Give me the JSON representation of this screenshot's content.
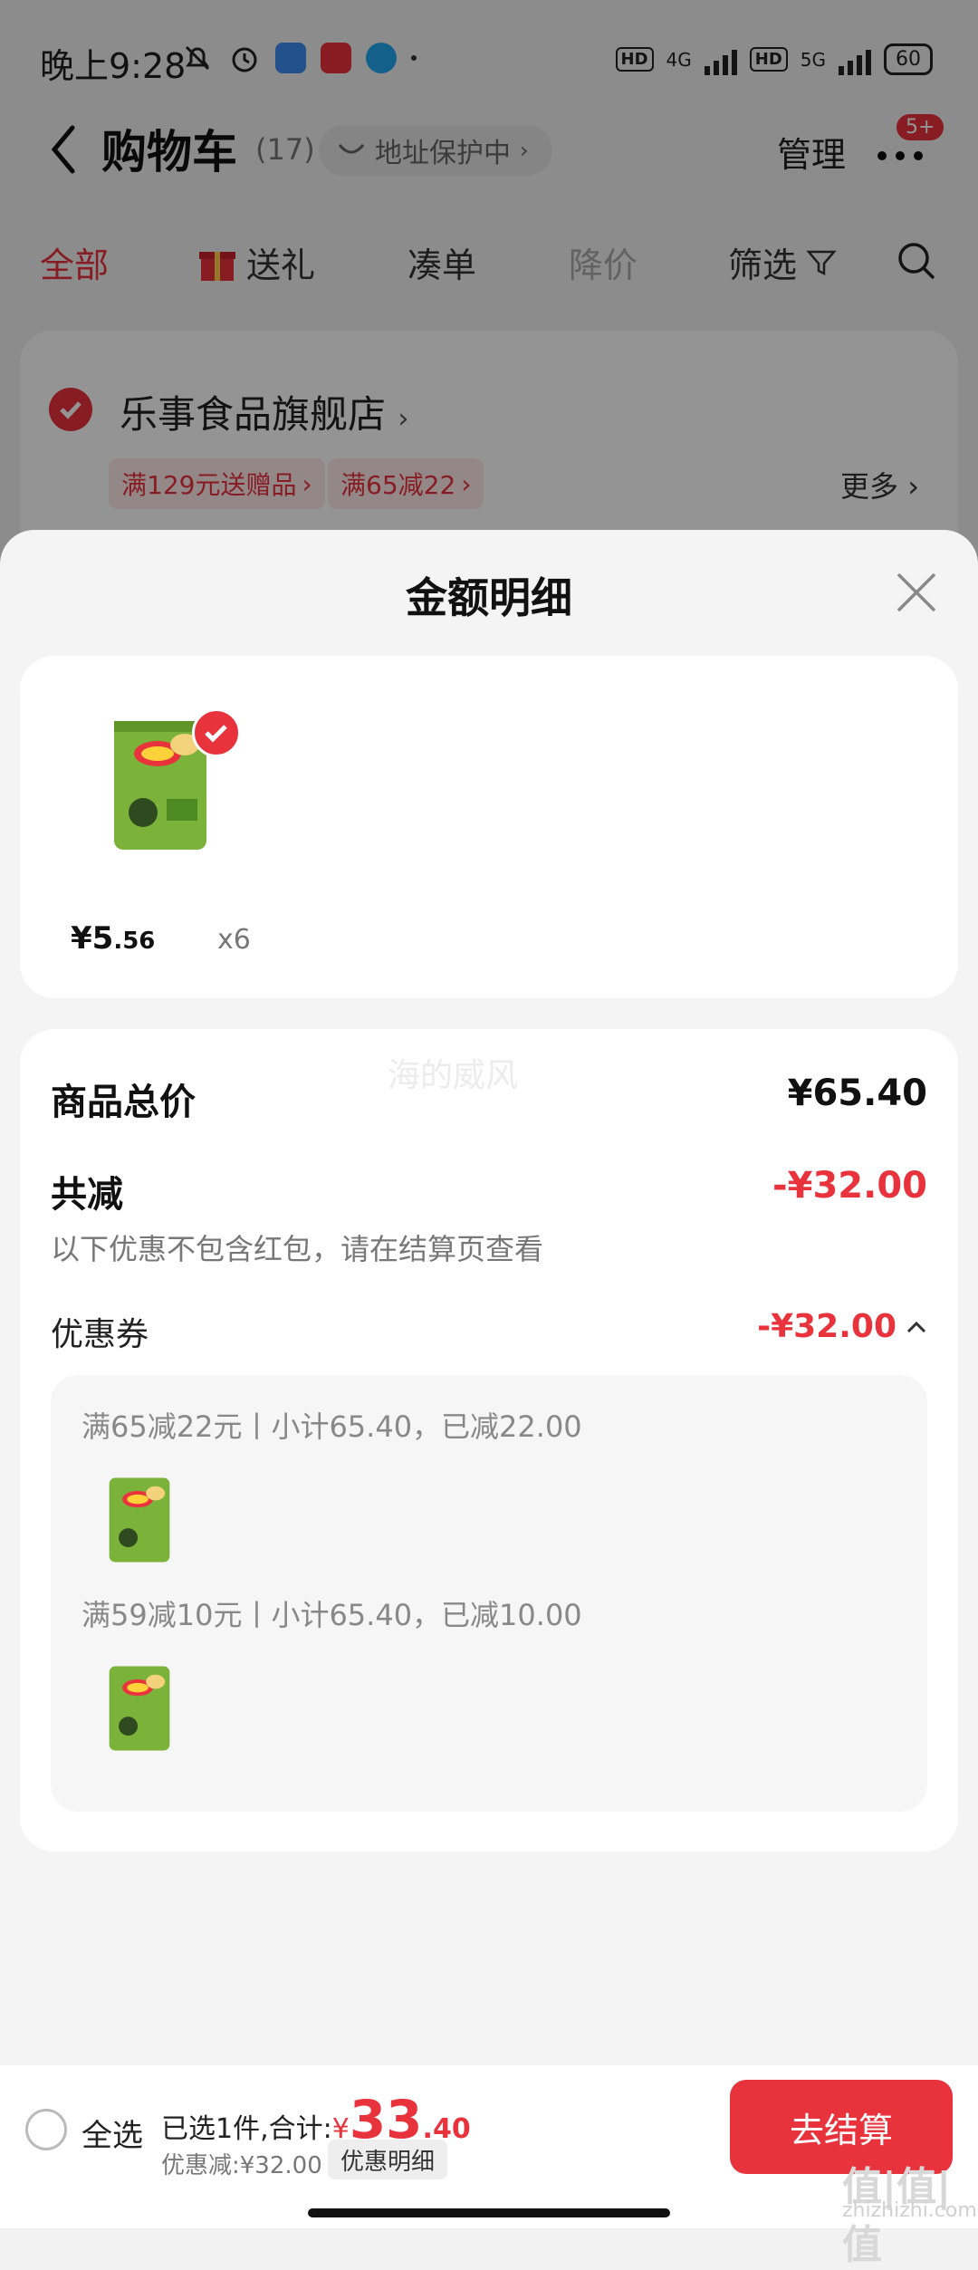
{
  "status_bar": {
    "time": "晚上9:28",
    "network_1": "4G",
    "network_2": "5G",
    "hd": "HD",
    "battery": "60"
  },
  "header": {
    "title": "购物车",
    "count": "(17)",
    "address_protect": "地址保护中",
    "manage": "管理",
    "more_badge": "5+"
  },
  "tabs": [
    {
      "label": "全部"
    },
    {
      "label": "送礼"
    },
    {
      "label": "凑单"
    },
    {
      "label": "降价"
    },
    {
      "label": "筛选"
    }
  ],
  "store": {
    "name": "乐事食品旗舰店",
    "promos": [
      "满129元送赠品",
      "满65减22"
    ],
    "more": "更多"
  },
  "sheet": {
    "title": "金额明细",
    "product": {
      "price_int": "¥5",
      "price_dec": ".56",
      "quantity": "x6"
    },
    "watermark": "海的威风",
    "total_label": "商品总价",
    "total_value": "¥65.40",
    "reduce_label": "共减",
    "reduce_value": "-¥32.00",
    "reduce_note": "以下优惠不包含红包，请在结算页查看",
    "coupon_label": "优惠券",
    "coupon_value": "-¥32.00",
    "coupons": [
      {
        "text": "满65减22元丨小计65.40，已减22.00"
      },
      {
        "text": "满59减10元丨小计65.40，已减10.00"
      }
    ]
  },
  "bottom": {
    "select_all": "全选",
    "summary_prefix": "已选1件,合计:",
    "yen": "¥",
    "total_int": "33",
    "total_dec": ".40",
    "discount": "优惠减:¥32.00",
    "detail_button": "优惠明细",
    "checkout": "去结算"
  },
  "site_mark": "值|值|值",
  "site_url": "zhizhizhi.com"
}
